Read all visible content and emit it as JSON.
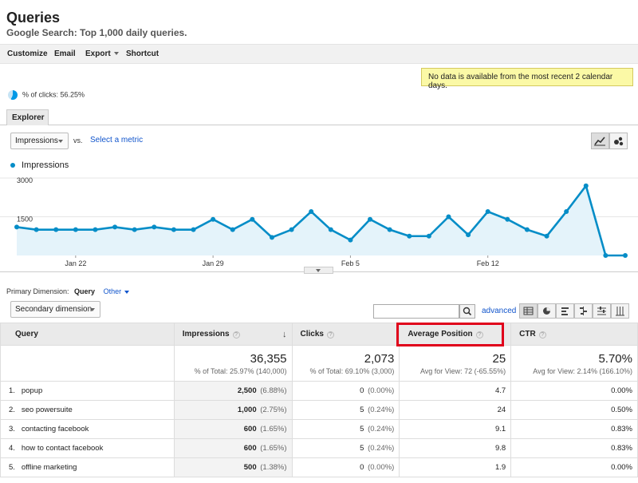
{
  "header": {
    "title": "Queries",
    "subtitle": "Google Search: Top 1,000 daily queries."
  },
  "toolbar": {
    "customize": "Customize",
    "email": "Email",
    "export": "Export",
    "shortcut": "Shortcut"
  },
  "notice": "No data is available from the most recent 2 calendar days.",
  "pct_clicks": "% of clicks: 56.25%",
  "explorer": {
    "tab": "Explorer",
    "metric": "Impressions",
    "vs": "vs.",
    "select_metric": "Select a metric",
    "legend": "Impressions"
  },
  "chart_data": {
    "type": "area",
    "series": [
      {
        "name": "Impressions",
        "values": [
          1100,
          1000,
          1000,
          1000,
          1000,
          1100,
          1000,
          1100,
          1000,
          1000,
          1400,
          1000,
          1400,
          700,
          1000,
          1700,
          1000,
          600,
          1400,
          1000,
          750,
          750,
          1500,
          800,
          1700,
          1400,
          1000,
          750,
          1700,
          2700,
          0,
          0
        ]
      }
    ],
    "x_tick_labels": [
      "Jan 22",
      "Jan 29",
      "Feb 5",
      "Feb 12"
    ],
    "y_tick_labels": [
      "3000",
      "1500"
    ],
    "ylim": [
      0,
      3000
    ],
    "color": "#058dc7",
    "fill": "#e4f3fa"
  },
  "primary_dimension": {
    "label": "Primary Dimension:",
    "value": "Query",
    "other": "Other"
  },
  "table_controls": {
    "secondary_dimension": "Secondary dimension",
    "advanced": "advanced"
  },
  "table": {
    "headers": [
      "Query",
      "Impressions",
      "Clicks",
      "Average Position",
      "CTR"
    ],
    "totals": [
      {
        "value": "36,355",
        "sub": "% of Total: 25.97% (140,000)"
      },
      {
        "value": "2,073",
        "sub": "% of Total: 69.10% (3,000)"
      },
      {
        "value": "25",
        "sub": "Avg for View: 72 (-65.55%)"
      },
      {
        "value": "5.70%",
        "sub": "Avg for View: 2.14% (166.10%)"
      }
    ],
    "rows": [
      {
        "rank": "1.",
        "query": "popup",
        "impressions": "2,500",
        "imp_share": "(6.88%)",
        "clicks": "0",
        "clicks_share": "(0.00%)",
        "position": "4.7",
        "ctr": "0.00%"
      },
      {
        "rank": "2.",
        "query": "seo powersuite",
        "impressions": "1,000",
        "imp_share": "(2.75%)",
        "clicks": "5",
        "clicks_share": "(0.24%)",
        "position": "24",
        "ctr": "0.50%"
      },
      {
        "rank": "3.",
        "query": "contacting facebook",
        "impressions": "600",
        "imp_share": "(1.65%)",
        "clicks": "5",
        "clicks_share": "(0.24%)",
        "position": "9.1",
        "ctr": "0.83%"
      },
      {
        "rank": "4.",
        "query": "how to contact facebook",
        "impressions": "600",
        "imp_share": "(1.65%)",
        "clicks": "5",
        "clicks_share": "(0.24%)",
        "position": "9.8",
        "ctr": "0.83%"
      },
      {
        "rank": "5.",
        "query": "offline marketing",
        "impressions": "500",
        "imp_share": "(1.38%)",
        "clicks": "0",
        "clicks_share": "(0.00%)",
        "position": "1.9",
        "ctr": "0.00%"
      }
    ]
  }
}
